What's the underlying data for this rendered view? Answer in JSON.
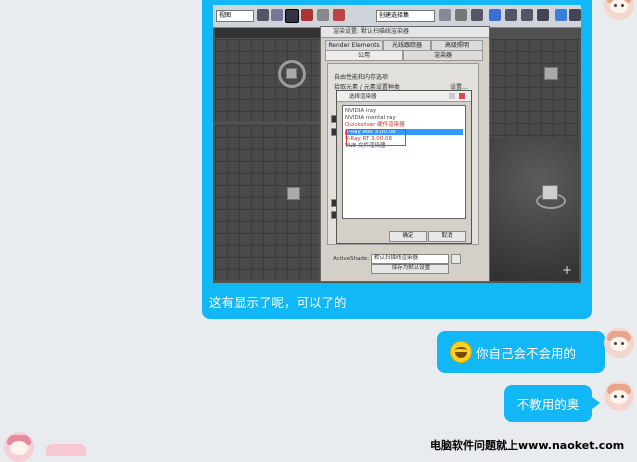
{
  "messages": {
    "caption": "这有显示了呢，可以了的",
    "msg2": "你自己会不会用的",
    "msg3": "不教用的奥"
  },
  "render_setup": {
    "title": "渲染设置: 默认扫描线渲染器",
    "tabs": [
      "Render Elements",
      "光线跟踪器",
      "高级照明",
      "公用",
      "渲染器"
    ],
    "lines": [
      "自由性能和内存选项",
      "拾取元素 / 元素设置种类",
      "设置..."
    ],
    "activeshade_label": "ActiveShade:",
    "activeshade_value": "默认扫描线渲染器",
    "save_default": "保存为默认设置"
  },
  "choose_renderer": {
    "title": "选择渲染器",
    "items": [
      "NVIDIA iray",
      "NVIDIA mental ray",
      "Quicksilver 硬件渲染器",
      "V-Ray Adv 3.00.08",
      "V-Ray RT 3.00.08",
      "VUE 文件渲染器"
    ],
    "selected_index": 3,
    "ok": "确定",
    "cancel": "取消"
  },
  "toolbar": {
    "view_dropdown": "视图",
    "selection_dropdown": "创建选择集"
  },
  "watermark": "电脑软件问题就上www.naoket.com",
  "colors": {
    "bubble": "#12b7f5",
    "background": "#e9ecef"
  }
}
